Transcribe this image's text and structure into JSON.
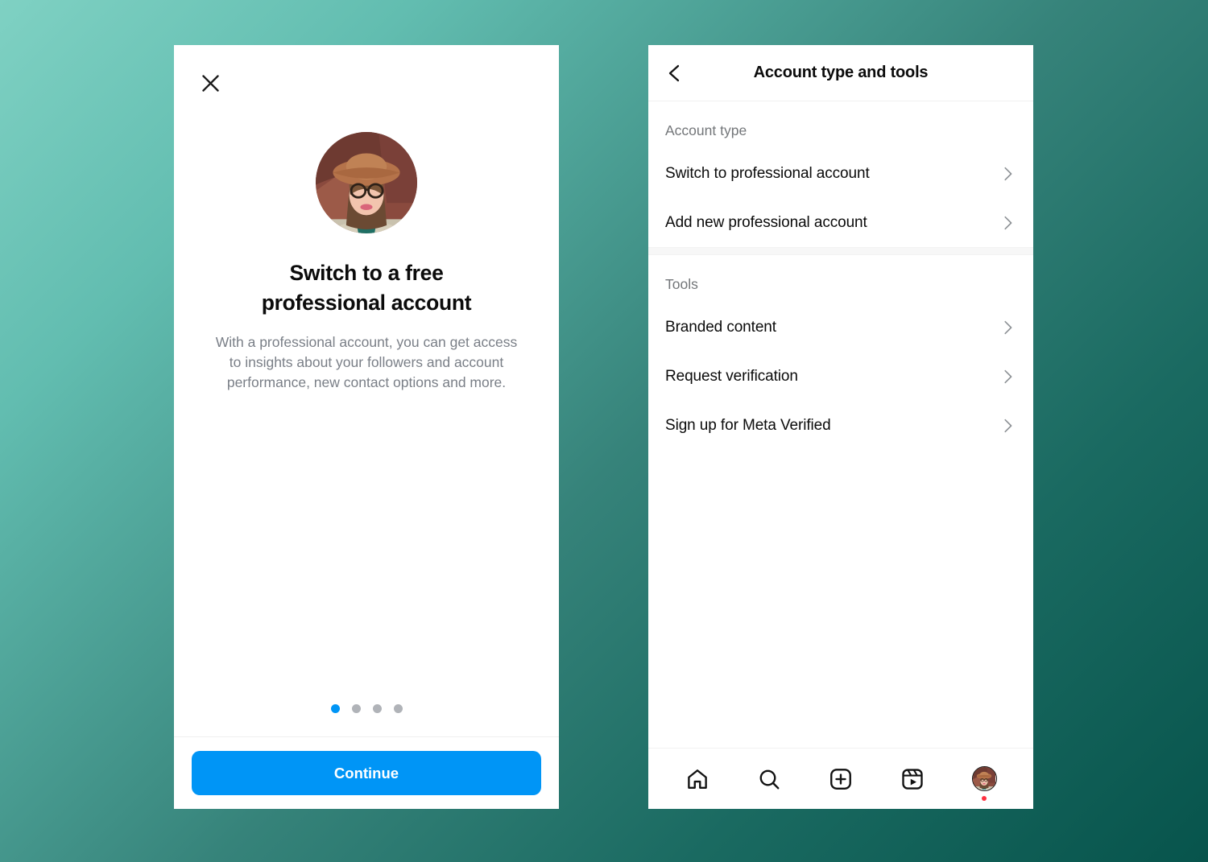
{
  "theme": {
    "background_gradient_from": "#7FD1C3",
    "background_gradient_to": "#07544C",
    "accent_blue": "#0095F6",
    "badge_red": "#FF3040",
    "muted_text": "#7A7F87",
    "section_label_text": "#737679"
  },
  "left_screen": {
    "close_icon": "close-icon",
    "avatar": "user-profile-photo",
    "headline_line_1": "Switch to a free",
    "headline_line_2": "professional account",
    "subtext": "With a professional account, you can get access to insights about your followers and account performance, new contact options and more.",
    "pagination": {
      "total": 4,
      "active_index": 0
    },
    "continue_label": "Continue"
  },
  "right_screen": {
    "header": {
      "back_icon": "chevron-left-icon",
      "title": "Account type and tools"
    },
    "sections": [
      {
        "label": "Account type",
        "items": [
          {
            "label": "Switch to professional account",
            "chevron": "chevron-right-icon"
          },
          {
            "label": "Add new professional account",
            "chevron": "chevron-right-icon"
          }
        ]
      },
      {
        "label": "Tools",
        "items": [
          {
            "label": "Branded content",
            "chevron": "chevron-right-icon"
          },
          {
            "label": "Request verification",
            "chevron": "chevron-right-icon"
          },
          {
            "label": "Sign up for Meta Verified",
            "chevron": "chevron-right-icon"
          }
        ]
      }
    ],
    "tabbar": [
      {
        "icon": "home-icon",
        "label": "Home"
      },
      {
        "icon": "search-icon",
        "label": "Search"
      },
      {
        "icon": "create-plus-icon",
        "label": "Create"
      },
      {
        "icon": "reels-icon",
        "label": "Reels"
      },
      {
        "icon": "profile-avatar-icon",
        "label": "Profile"
      }
    ]
  }
}
